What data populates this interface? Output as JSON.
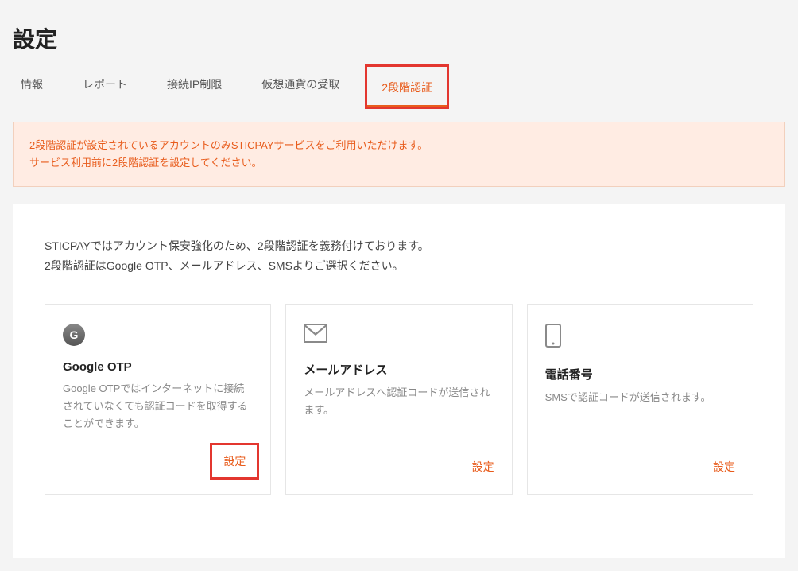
{
  "pageTitle": "設定",
  "tabs": [
    {
      "label": "情報"
    },
    {
      "label": "レポート"
    },
    {
      "label": "接続IP制限"
    },
    {
      "label": "仮想通貨の受取"
    },
    {
      "label": "2段階認証",
      "active": true
    }
  ],
  "notice": {
    "line1": "2段階認証が設定されているアカウントのみSTICPAYサービスをご利用いただけます。",
    "line2": "サービス利用前に2段階認証を設定してください。"
  },
  "intro": {
    "line1": "STICPAYではアカウント保安強化のため、2段階認証を義務付けております。",
    "line2": "2段階認証はGoogle OTP、メールアドレス、SMSよりご選択ください。"
  },
  "cards": {
    "google": {
      "title": "Google OTP",
      "desc": "Google OTPではインターネットに接続されていなくても認証コードを取得することができます。",
      "cta": "設定"
    },
    "email": {
      "title": "メールアドレス",
      "desc": "メールアドレスへ認証コードが送信されます。",
      "cta": "設定"
    },
    "phone": {
      "title": "電話番号",
      "desc": "SMSで認証コードが送信されます。",
      "cta": "設定"
    }
  },
  "colors": {
    "accent": "#e85c1c",
    "highlight": "#e3362f"
  }
}
